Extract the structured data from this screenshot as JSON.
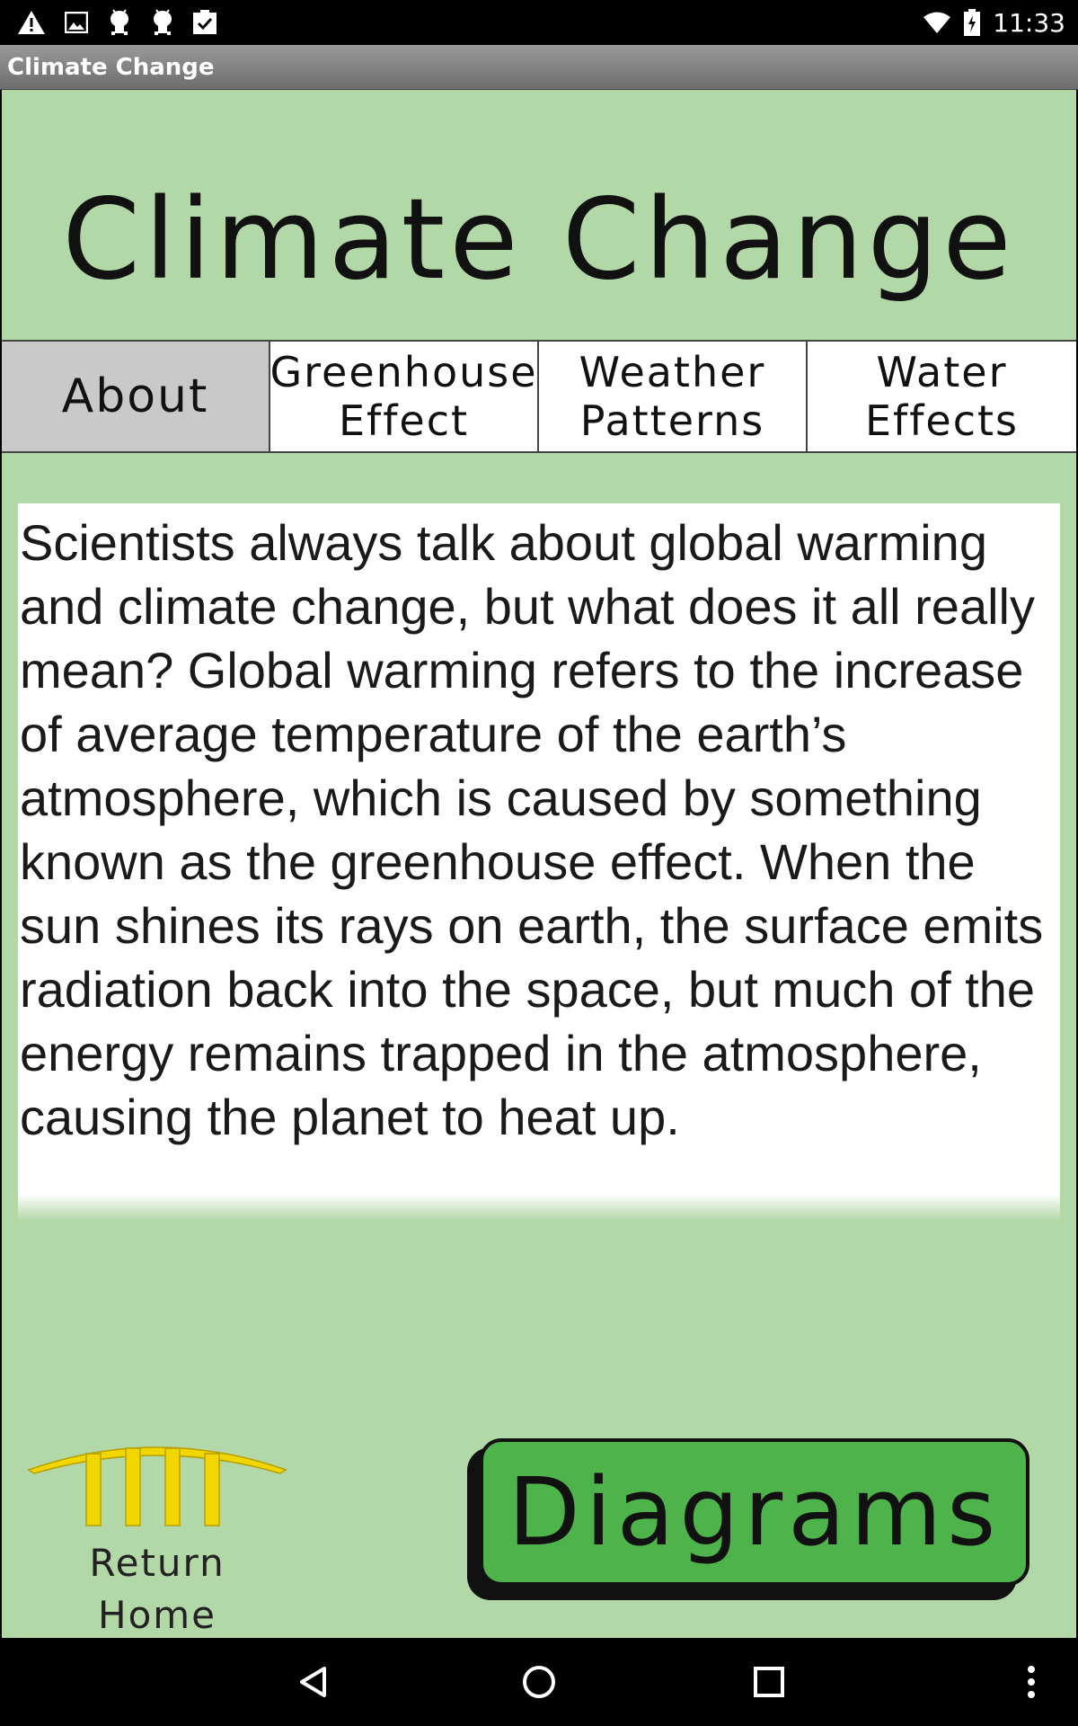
{
  "status_bar": {
    "time": "11:33",
    "left_icons": [
      "warning-icon",
      "image-icon",
      "android-icon",
      "android-icon",
      "clipboard-check-icon"
    ],
    "right_icons": [
      "wifi-icon",
      "battery-charging-icon"
    ]
  },
  "app_bar": {
    "title": "Climate Change"
  },
  "page": {
    "heading": "Climate Change",
    "tabs": [
      {
        "line1": "About",
        "line2": "",
        "active": true
      },
      {
        "line1": "Greenhouse",
        "line2": "Effect",
        "active": false
      },
      {
        "line1": "Weather",
        "line2": "Patterns",
        "active": false
      },
      {
        "line1": "Water",
        "line2": "Effects",
        "active": false
      }
    ],
    "body_text": "Scientists always talk about global warming and climate change, but what does it all really mean?  Global warming refers to the increase of average temperature of the earth’s atmosphere, which is caused by something known as the greenhouse effect. When the sun shines its rays on earth, the surface emits radiation back into the space, but much of the energy remains trapped in the atmosphere, causing the planet to heat up."
  },
  "return_home": {
    "line1": "Return",
    "line2": "Home",
    "icon": "pillars-icon"
  },
  "diagrams_button": {
    "label": "Diagrams"
  },
  "nav_bar": {
    "icons": [
      "back-icon",
      "home-icon",
      "recents-icon",
      "more-icon"
    ]
  },
  "colors": {
    "background": "#b3d8a8",
    "active_tab": "#c9c9c9",
    "button_green": "#4fb34b",
    "pillars_yellow": "#f2d600"
  }
}
